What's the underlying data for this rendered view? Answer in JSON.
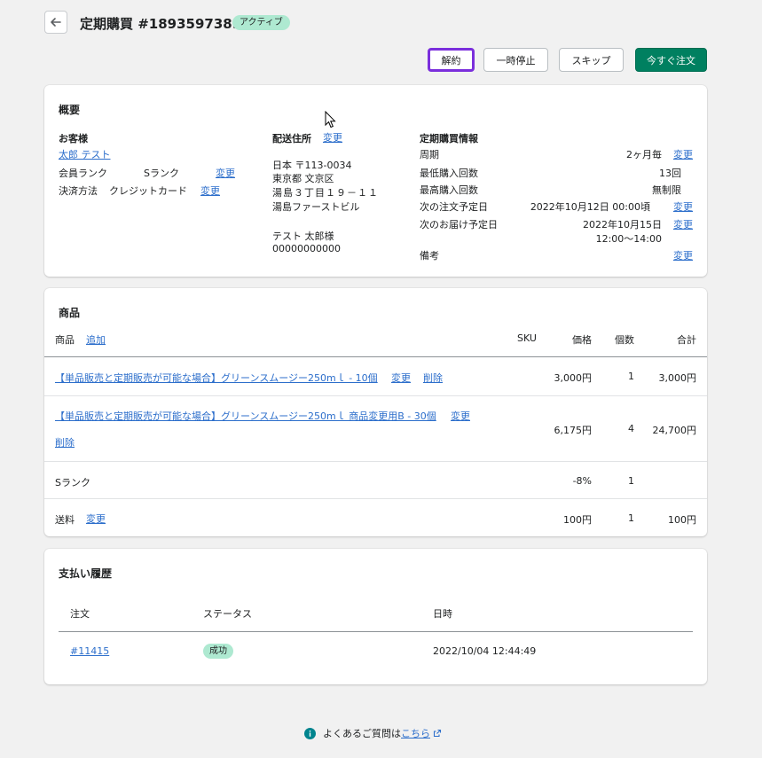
{
  "header": {
    "title": "定期購買 #1893597389",
    "status": "アクティブ",
    "actions": {
      "cancel": "解約",
      "pause": "一時停止",
      "skip": "スキップ",
      "order_now": "今すぐ注文"
    }
  },
  "overview": {
    "title": "概要",
    "customer": {
      "heading": "お客様",
      "name": "太郎 テスト",
      "rank_label": "会員ランク",
      "rank_value": "Sランク",
      "rank_change": "変更",
      "payment_label": "決済方法",
      "payment_value": "クレジットカード",
      "payment_change": "変更"
    },
    "shipping": {
      "heading": "配送住所",
      "change": "変更",
      "line1": "日本 〒113-0034",
      "line2": "東京都 文京区",
      "line3": "湯島３丁目１９－１１",
      "line4": "湯島ファーストビル",
      "name": "テスト 太郎様",
      "phone": "00000000000"
    },
    "subscription": {
      "heading": "定期購買情報",
      "cycle_label": "周期",
      "cycle_value": "2ヶ月毎",
      "cycle_change": "変更",
      "min_label": "最低購入回数",
      "min_value": "13回",
      "max_label": "最高購入回数",
      "max_value": "無制限",
      "next_order_label": "次の注文予定日",
      "next_order_value": "2022年10月12日 00:00頃",
      "next_order_change": "変更",
      "next_delivery_label": "次のお届け予定日",
      "next_delivery_date": "2022年10月15日",
      "next_delivery_time": "12:00〜14:00",
      "next_delivery_change": "変更",
      "note_label": "備考",
      "note_change": "変更"
    }
  },
  "products": {
    "title": "商品",
    "columns": {
      "product": "商品",
      "add": "追加",
      "sku": "SKU",
      "price": "価格",
      "qty": "個数",
      "total": "合計"
    },
    "rows": [
      {
        "name": "【単品販売と定期販売が可能な場合】グリーンスムージー250mｌ - 10個",
        "change": "変更",
        "delete": "削除",
        "price": "3,000円",
        "qty": "1",
        "total": "3,000円"
      },
      {
        "name": "【単品販売と定期販売が可能な場合】グリーンスムージー250mｌ 商品変更用B - 30個",
        "change": "変更",
        "delete": "削除",
        "price": "6,175円",
        "qty": "4",
        "total": "24,700円"
      }
    ],
    "discount": {
      "label": "Sランク",
      "price": "-8%",
      "qty": "1"
    },
    "shipping": {
      "label": "送料",
      "change": "変更",
      "price": "100円",
      "qty": "1",
      "total": "100円"
    }
  },
  "payments": {
    "title": "支払い履歴",
    "columns": {
      "order": "注文",
      "status": "ステータス",
      "date": "日時"
    },
    "rows": [
      {
        "order": "#11415",
        "status": "成功",
        "date": "2022/10/04 12:44:49"
      }
    ]
  },
  "footer": {
    "text": "よくあるご質問は",
    "link": "こちら"
  },
  "colors": {
    "primary": "#008060",
    "badge": "#aee9d1",
    "link": "#2c6ecb",
    "focus": "#7b2fdc"
  }
}
